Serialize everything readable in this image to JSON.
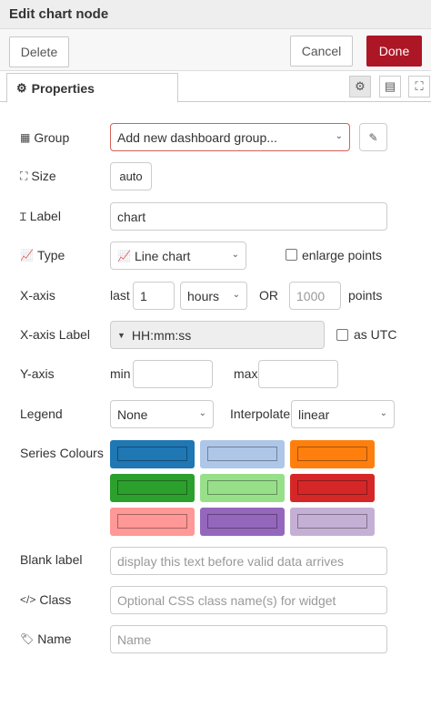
{
  "title": "Edit chart node",
  "toolbar": {
    "delete": "Delete",
    "cancel": "Cancel",
    "done": "Done"
  },
  "tabs": {
    "properties": "Properties"
  },
  "form": {
    "group": {
      "label": "Group",
      "value": "Add new dashboard group..."
    },
    "size": {
      "label": "Size",
      "value": "auto"
    },
    "label": {
      "label": "Label",
      "value": "chart"
    },
    "type": {
      "label": "Type",
      "value": "Line chart",
      "enlarge_points": "enlarge points"
    },
    "xaxis": {
      "label": "X-axis",
      "last": "last",
      "count": "1",
      "unit": "hours",
      "or": "OR",
      "points_placeholder": "1000",
      "points": "points"
    },
    "xaxis_label": {
      "label": "X-axis Label",
      "value": "HH:mm:ss",
      "as_utc": "as UTC"
    },
    "yaxis": {
      "label": "Y-axis",
      "min": "min",
      "max": "max"
    },
    "legend": {
      "label": "Legend",
      "value": "None",
      "interpolate_label": "Interpolate",
      "interpolate_value": "linear"
    },
    "series_colours": {
      "label": "Series Colours",
      "colors": [
        "#1f77b4",
        "#aec7e8",
        "#ff7f0e",
        "#2ca02c",
        "#98df8a",
        "#d62728",
        "#ff9896",
        "#9467bd",
        "#c5b0d5"
      ]
    },
    "blank_label": {
      "label": "Blank label",
      "placeholder": "display this text before valid data arrives"
    },
    "class": {
      "label": "Class",
      "placeholder": "Optional CSS class name(s) for widget"
    },
    "name": {
      "label": "Name",
      "placeholder": "Name"
    }
  }
}
